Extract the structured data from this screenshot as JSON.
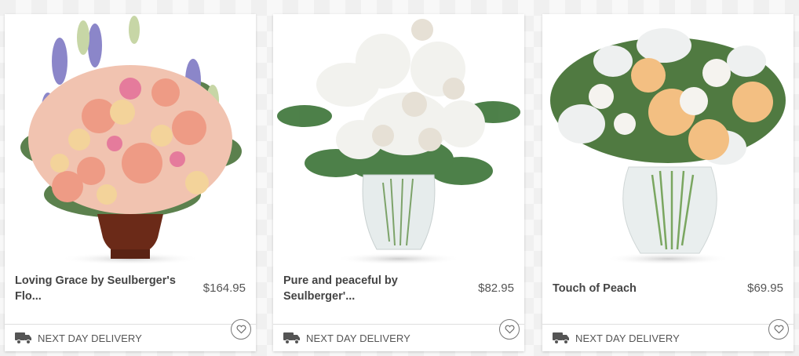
{
  "products": [
    {
      "title": "Loving Grace by Seulberger's Flo...",
      "price": "$164.95",
      "delivery": "NEXT DAY DELIVERY",
      "image_icon": "pink-peach-funeral-arrangement-in-urn"
    },
    {
      "title": "Pure and peaceful by Seulberger'...",
      "price": "$82.95",
      "delivery": "NEXT DAY DELIVERY",
      "image_icon": "white-lilies-roses-vase"
    },
    {
      "title": "Touch of Peach",
      "price": "$69.95",
      "delivery": "NEXT DAY DELIVERY",
      "image_icon": "peach-white-roses-vase"
    }
  ],
  "icons": {
    "delivery": "delivery-truck-icon",
    "favorite": "heart-icon"
  },
  "colors": {
    "text": "#444444",
    "price": "#555555",
    "background": "#f0f0f0"
  }
}
